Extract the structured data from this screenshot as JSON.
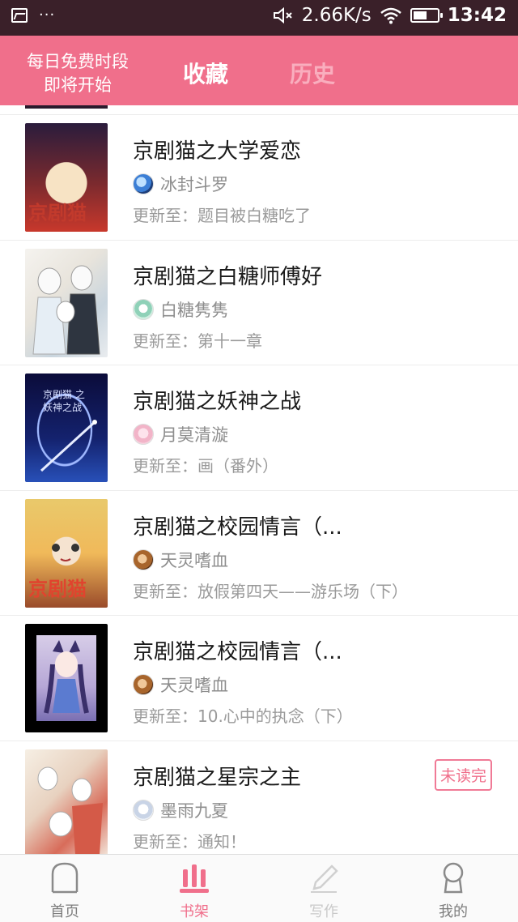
{
  "status_bar": {
    "dots": "···",
    "network_speed": "2.66K/s",
    "time": "13:42",
    "battery_level": 0.56
  },
  "header": {
    "promo_line1": "每日免费时段",
    "promo_line2": "即将开始",
    "tab_favorites": "收藏",
    "tab_history": "历史",
    "colors": {
      "header_bg": "#f06f8b",
      "active_tab": "#ffffff",
      "inactive_tab": "#f9aebe"
    }
  },
  "list": {
    "items": [
      {
        "title": "京剧猫之大学爱恋",
        "author": "冰封斗罗",
        "update": "更新至：题目被白糖吃了",
        "cover_text": "京剧猫",
        "badge": ""
      },
      {
        "title": "京剧猫之白糖师傅好",
        "author": "白糖隽隽",
        "update": "更新至：第十一章",
        "cover_text": "",
        "badge": ""
      },
      {
        "title": "京剧猫之妖神之战",
        "author": "月莫清漩",
        "update": "更新至：画（番外）",
        "cover_text": "京剧猫 之 妖神之战",
        "badge": ""
      },
      {
        "title": "京剧猫之校园情言（...",
        "author": "天灵嗜血",
        "update": "更新至：放假第四天——游乐场（下）",
        "cover_text": "京剧猫",
        "badge": ""
      },
      {
        "title": "京剧猫之校园情言（...",
        "author": "天灵嗜血",
        "update": "更新至：10.心中的执念（下）",
        "cover_text": "",
        "badge": ""
      },
      {
        "title": "京剧猫之星宗之主",
        "author": "墨雨九夏",
        "update": "更新至：通知！",
        "cover_text": "",
        "badge": "未读完"
      }
    ]
  },
  "bottom_nav": {
    "home": "首页",
    "bookshelf": "书架",
    "write": "写作",
    "mine": "我的",
    "active": "书架",
    "accent": "#f06f8b"
  }
}
